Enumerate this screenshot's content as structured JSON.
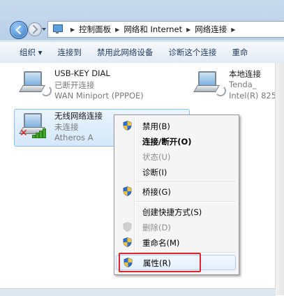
{
  "address": {
    "crumbs": [
      "控制面板",
      "网络和 Internet",
      "网络连接"
    ]
  },
  "toolbar": {
    "organize": "组织 ▾",
    "connect_to": "连接到",
    "disable_device": "禁用此网络设备",
    "diagnose": "诊断这个连接",
    "rename_partial": "重命"
  },
  "connections": [
    {
      "name": "USB-KEY DIAL",
      "status": "已断开连接",
      "device": "WAN Miniport (PPPOE)"
    },
    {
      "name": "本地连接",
      "status": "Tenda_",
      "device": "Intel(R) 825"
    },
    {
      "name": "无线网络连接",
      "status": "未连接",
      "device": "Atheros A"
    }
  ],
  "context_menu": {
    "items": [
      {
        "label": "禁用(B)",
        "shield": true
      },
      {
        "label": "连接/断开(O)",
        "bold": true
      },
      {
        "label": "状态(U)",
        "disabled": true
      },
      {
        "label": "诊断(I)"
      },
      {
        "label": "桥接(G)",
        "shield": true
      },
      {
        "label": "创建快捷方式(S)"
      },
      {
        "label": "删除(D)",
        "disabled": true,
        "shield": true
      },
      {
        "label": "重命名(M)",
        "shield": true
      },
      {
        "label": "属性(R)",
        "shield": true
      }
    ]
  },
  "colors": {
    "highlight_border": "#e0242b",
    "toolbar_text": "#1e395b"
  }
}
